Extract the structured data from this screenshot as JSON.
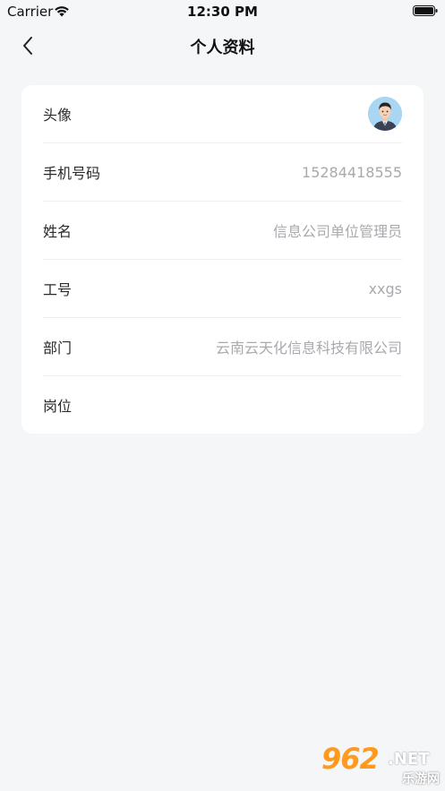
{
  "status_bar": {
    "carrier": "Carrier",
    "time": "12:30 PM"
  },
  "nav": {
    "title": "个人资料",
    "back_icon": "chevron-left-icon"
  },
  "profile": {
    "rows": [
      {
        "label": "头像",
        "value": ""
      },
      {
        "label": "手机号码",
        "value": "15284418555"
      },
      {
        "label": "姓名",
        "value": "信息公司单位管理员"
      },
      {
        "label": "工号",
        "value": "xxgs"
      },
      {
        "label": "部门",
        "value": "云南云天化信息科技有限公司"
      },
      {
        "label": "岗位",
        "value": ""
      }
    ]
  },
  "watermark": {
    "logo": "962",
    "suffix": ".NET",
    "sub": "乐游网"
  },
  "colors": {
    "background": "#f5f6f8",
    "card": "#ffffff",
    "value_text": "#a9a9ae",
    "watermark": "#ff9a1f"
  }
}
